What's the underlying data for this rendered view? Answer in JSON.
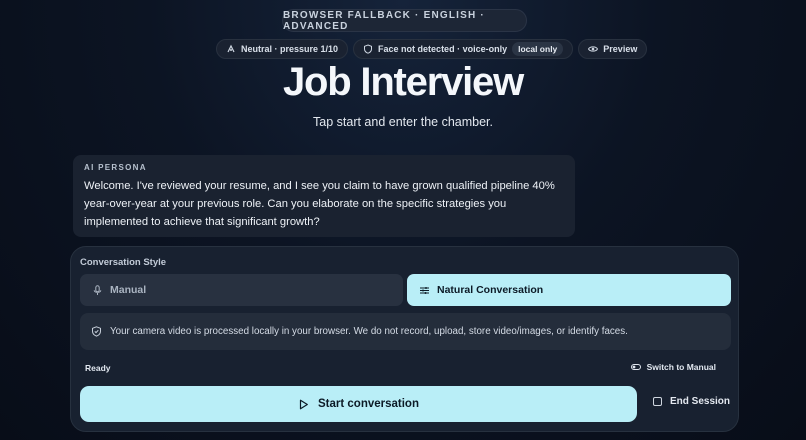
{
  "banner": "BROWSER FALLBACK · ENGLISH · ADVANCED",
  "status_chips": {
    "mood": "Neutral · pressure 1/10",
    "face": "Face not detected · voice-only",
    "face_tag": "local only",
    "preview": "Preview"
  },
  "header": {
    "title": "Job Interview",
    "subtitle": "Tap start and enter the chamber."
  },
  "persona": {
    "label": "AI PERSONA",
    "message": "Welcome. I've reviewed your resume, and I see you claim to have grown qualified pipeline 40% year-over-year at your previous role. Can you elaborate on the specific strategies you implemented to achieve that significant growth?"
  },
  "conversation": {
    "style_label": "Conversation Style",
    "options": [
      "Manual",
      "Natural Conversation"
    ],
    "selected": "Natural Conversation",
    "privacy_notice": "Your camera video is processed locally in your browser. We do not record, upload, store video/images, or identify faces.",
    "status": "Ready",
    "switch_label": "Switch to Manual",
    "start_label": "Start conversation",
    "end_label": "End Session"
  },
  "colors": {
    "accent": "#b9eef7",
    "background": "#0c1423",
    "panel": "#182130"
  }
}
